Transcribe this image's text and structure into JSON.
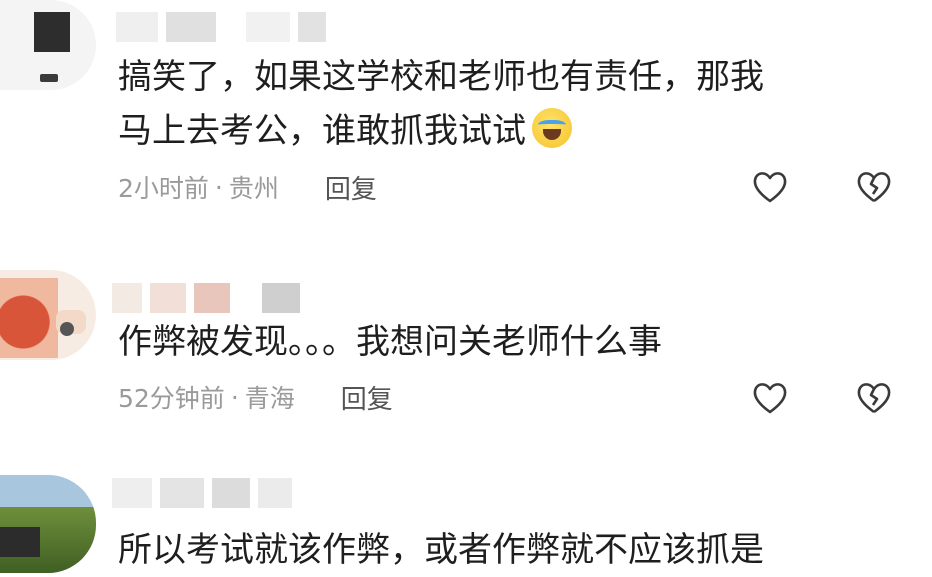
{
  "comments": [
    {
      "text_lines": [
        "搞笑了，如果这学校和老师也有责任，那我",
        "马上去考公，谁敢抓我试试"
      ],
      "emoji": "laughing-crying-emoji",
      "time": "2小时前",
      "separator": "·",
      "location": "贵州",
      "reply_label": "回复"
    },
    {
      "text_lines": [
        "作弊被发现。。。我想问关老师什么事"
      ],
      "time": "52分钟前",
      "separator": "·",
      "location": "青海",
      "reply_label": "回复"
    },
    {
      "text_lines": [
        "所以考试就该作弊，或者作弊就不应该抓是"
      ]
    }
  ],
  "icons": {
    "like": "heart-outline-icon",
    "dislike": "broken-heart-icon"
  },
  "colors": {
    "text": "#1e1e1e",
    "meta": "#9a9a9a",
    "reply": "#555555",
    "icon_stroke": "#3a3a3a",
    "username_blur": "#e3e3e3"
  }
}
